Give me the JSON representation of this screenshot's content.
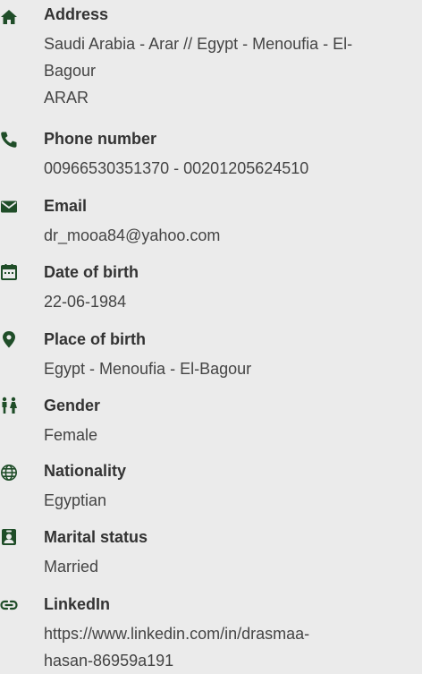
{
  "items": [
    {
      "icon": "home-icon",
      "label": "Address",
      "lines": [
        "Saudi Arabia - Arar // Egypt - Menoufia - El-",
        "Bagour",
        "ARAR"
      ]
    },
    {
      "icon": "phone-icon",
      "label": "Phone number",
      "lines": [
        "00966530351370 - 00201205624510"
      ]
    },
    {
      "icon": "envelope-icon",
      "label": "Email",
      "lines": [
        "dr_mooa84@yahoo.com"
      ]
    },
    {
      "icon": "calendar-icon",
      "label": "Date of birth",
      "lines": [
        "22-06-1984"
      ]
    },
    {
      "icon": "map-pin-icon",
      "label": "Place of birth",
      "lines": [
        "Egypt - Menoufia - El-Bagour"
      ]
    },
    {
      "icon": "gender-icon",
      "label": "Gender",
      "lines": [
        "Female"
      ]
    },
    {
      "icon": "globe-icon",
      "label": "Nationality",
      "lines": [
        "Egyptian"
      ]
    },
    {
      "icon": "id-badge-icon",
      "label": "Marital status",
      "lines": [
        "Married"
      ]
    },
    {
      "icon": "link-icon",
      "label": "LinkedIn",
      "lines": [
        "https://www.linkedin.com/in/drasmaa-",
        "hasan-86959a191"
      ]
    }
  ],
  "colors": {
    "icon": "#1f4d28",
    "label": "#333333",
    "value": "#444444",
    "background": "#ebebeb"
  }
}
